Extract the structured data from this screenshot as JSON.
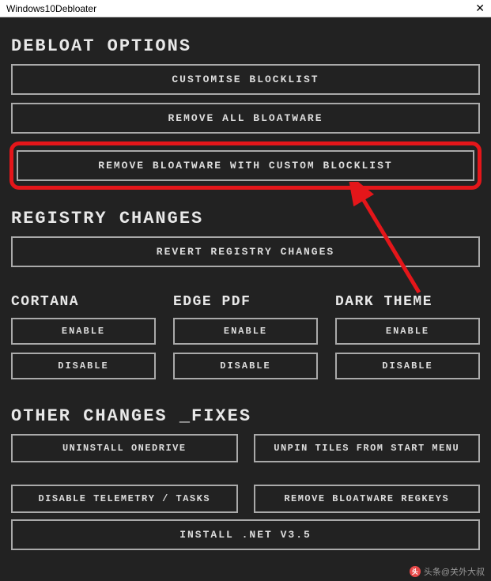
{
  "window": {
    "title": "Windows10Debloater",
    "close": "✕"
  },
  "sections": {
    "debloat": {
      "heading": "DEBLOAT OPTIONS",
      "customise": "CUSTOMISE BLOCKLIST",
      "remove_all": "REMOVE ALL BLOATWARE",
      "remove_custom": "REMOVE BLOATWARE WITH CUSTOM BLOCKLIST"
    },
    "registry": {
      "heading": "REGISTRY CHANGES",
      "revert": "REVERT REGISTRY CHANGES"
    },
    "cortana": {
      "heading": "CORTANA",
      "enable": "ENABLE",
      "disable": "DISABLE"
    },
    "edge_pdf": {
      "heading": "EDGE PDF",
      "enable": "ENABLE",
      "disable": "DISABLE"
    },
    "dark_theme": {
      "heading": "DARK THEME",
      "enable": "ENABLE",
      "disable": "DISABLE"
    },
    "other": {
      "heading": "OTHER CHANGES _FIXES",
      "uninstall_onedrive": "UNINSTALL ONEDRIVE",
      "unpin_tiles": "UNPIN TILES FROM START MENU",
      "disable_telemetry": "DISABLE TELEMETRY / TASKS",
      "remove_regkeys": "REMOVE BLOATWARE REGKEYS",
      "install_net": "INSTALL .NET V3.5"
    }
  },
  "watermark": "头条@关外大叔"
}
